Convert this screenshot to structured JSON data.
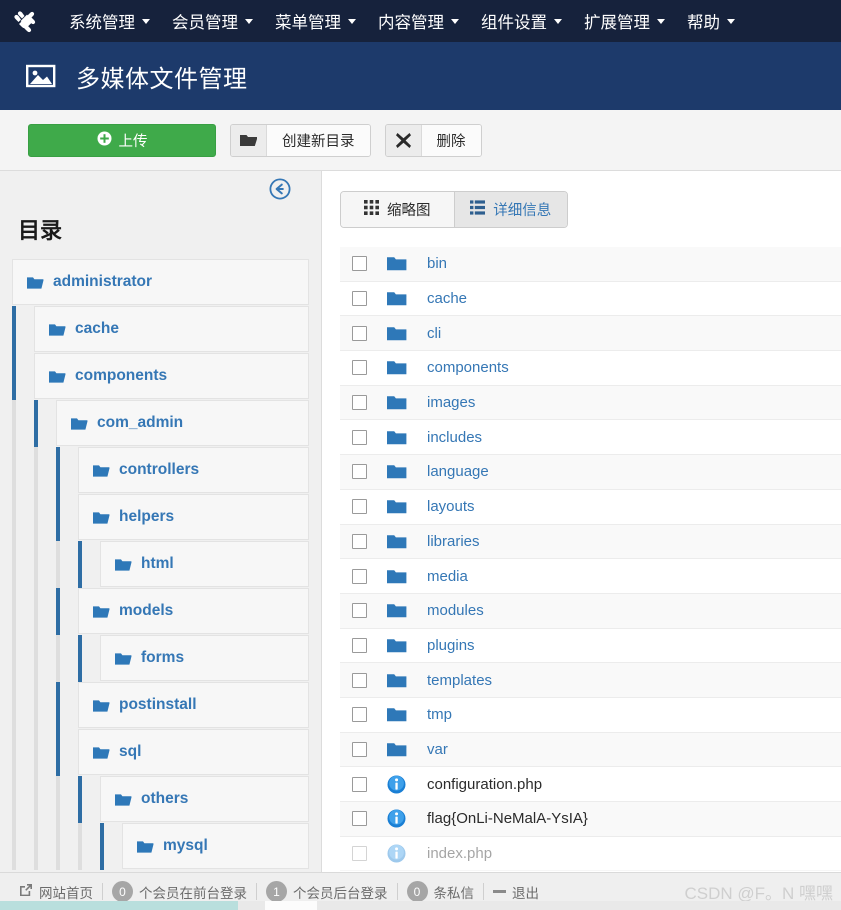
{
  "topbar": {
    "logo_icon": "joomla-logo-icon",
    "menu": [
      {
        "label": "系统管理",
        "caret": true
      },
      {
        "label": "会员管理",
        "caret": true
      },
      {
        "label": "菜单管理",
        "caret": true
      },
      {
        "label": "内容管理",
        "caret": true
      },
      {
        "label": "组件设置",
        "caret": true
      },
      {
        "label": "扩展管理",
        "caret": true
      },
      {
        "label": "帮助",
        "caret": true
      }
    ]
  },
  "header": {
    "icon": "image-media-icon",
    "title": "多媒体文件管理"
  },
  "toolbar": {
    "upload_label": "上传",
    "upload_icon": "plus-circle-icon",
    "upload_color": "#3faa4a",
    "newfolder_label": "创建新目录",
    "newfolder_icon": "folder-open-icon",
    "delete_label": "删除",
    "delete_icon": "x-mark-icon"
  },
  "sidebar": {
    "collapse_icon": "circle-arrow-left-icon",
    "title": "目录",
    "tree": [
      {
        "label": "administrator",
        "depth": 0
      },
      {
        "label": "cache",
        "depth": 1
      },
      {
        "label": "components",
        "depth": 1
      },
      {
        "label": "com_admin",
        "depth": 2
      },
      {
        "label": "controllers",
        "depth": 3
      },
      {
        "label": "helpers",
        "depth": 3
      },
      {
        "label": "html",
        "depth": 4
      },
      {
        "label": "models",
        "depth": 3
      },
      {
        "label": "forms",
        "depth": 4
      },
      {
        "label": "postinstall",
        "depth": 3
      },
      {
        "label": "sql",
        "depth": 3
      },
      {
        "label": "others",
        "depth": 4
      },
      {
        "label": "mysql",
        "depth": 5
      }
    ]
  },
  "main": {
    "view_tabs": [
      {
        "label": "缩略图",
        "icon": "grid-icon",
        "active": true
      },
      {
        "label": "详细信息",
        "icon": "list-icon",
        "active": false
      }
    ],
    "files": [
      {
        "name": "bin",
        "type": "folder"
      },
      {
        "name": "cache",
        "type": "folder"
      },
      {
        "name": "cli",
        "type": "folder"
      },
      {
        "name": "components",
        "type": "folder"
      },
      {
        "name": "images",
        "type": "folder"
      },
      {
        "name": "includes",
        "type": "folder"
      },
      {
        "name": "language",
        "type": "folder"
      },
      {
        "name": "layouts",
        "type": "folder"
      },
      {
        "name": "libraries",
        "type": "folder"
      },
      {
        "name": "media",
        "type": "folder"
      },
      {
        "name": "modules",
        "type": "folder"
      },
      {
        "name": "plugins",
        "type": "folder"
      },
      {
        "name": "templates",
        "type": "folder"
      },
      {
        "name": "tmp",
        "type": "folder"
      },
      {
        "name": "var",
        "type": "folder"
      },
      {
        "name": "configuration.php",
        "type": "file"
      },
      {
        "name": "flag{OnLi-NeMalA-YsIA}",
        "type": "file"
      },
      {
        "name": "index.php",
        "type": "file"
      }
    ]
  },
  "statusbar": {
    "home_icon": "external-link-icon",
    "home_label": "网站首页",
    "frontend_count": "0",
    "frontend_label": "个会员在前台登录",
    "backend_count": "1",
    "backend_label": "个会员后台登录",
    "message_count": "0",
    "message_label": "条私信",
    "logout_label": "退出",
    "watermark": "CSDN @F。N 嘿嘿"
  }
}
